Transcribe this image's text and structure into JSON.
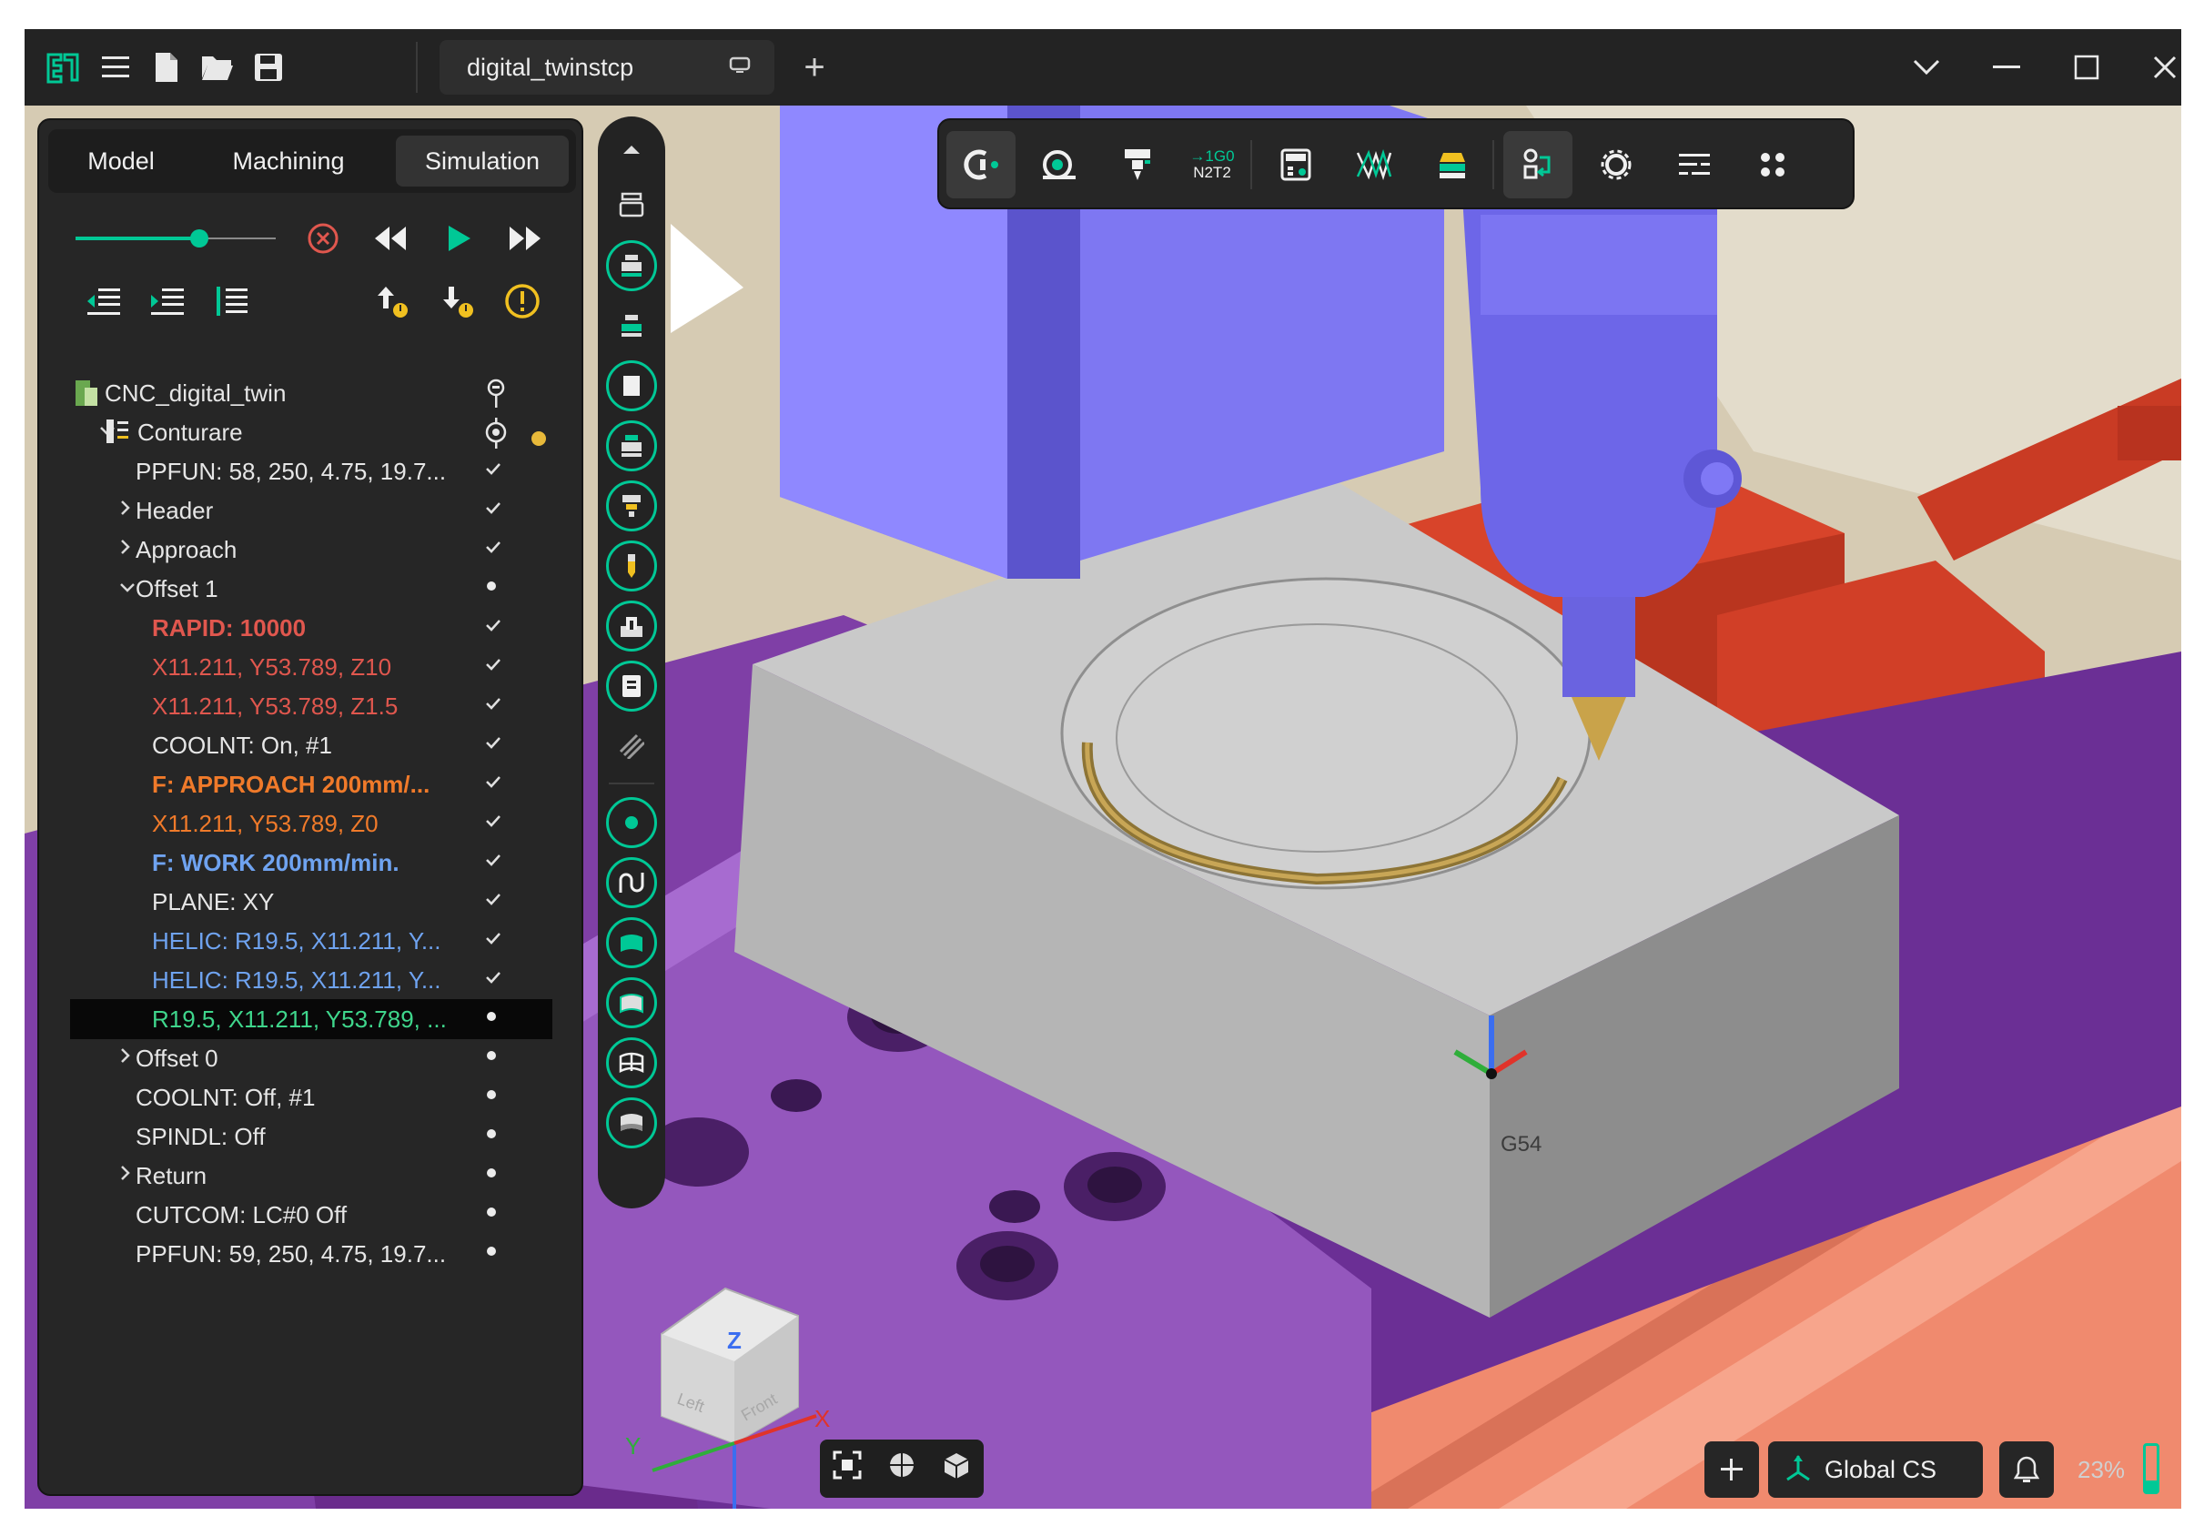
{
  "titlebar": {
    "tab_title": "digital_twinstcp",
    "new_tab_label": "+",
    "icons": [
      "app-logo-icon",
      "menu-icon",
      "new-file-icon",
      "open-folder-icon",
      "save-icon",
      "chevron-down-icon",
      "minimize-icon",
      "maximize-icon",
      "close-icon"
    ]
  },
  "panel": {
    "tabs": [
      {
        "label": "Model",
        "active": false
      },
      {
        "label": "Machining",
        "active": false
      },
      {
        "label": "Simulation",
        "active": true
      }
    ],
    "simulation_speed": 0.62,
    "tree": [
      {
        "label": "CNC_digital_twin",
        "color": "#e6e6e6",
        "bold": false,
        "indent": 0,
        "caret": "",
        "mark": "pin-icon"
      },
      {
        "label": "Conturare",
        "color": "#e6e6e6",
        "bold": false,
        "indent": 1,
        "caret": "expanded",
        "mark": "target-icon"
      },
      {
        "label": "PPFUN: 58, 250, 4.75, 19.7...",
        "color": "#e6e6e6",
        "bold": false,
        "indent": 2,
        "caret": "",
        "mark": "check"
      },
      {
        "label": "Header",
        "color": "#e6e6e6",
        "bold": false,
        "indent": 2,
        "caret": "collapsed",
        "mark": "check"
      },
      {
        "label": "Approach",
        "color": "#e6e6e6",
        "bold": false,
        "indent": 2,
        "caret": "collapsed",
        "mark": "check"
      },
      {
        "label": "Offset 1",
        "color": "#e6e6e6",
        "bold": false,
        "indent": 2,
        "caret": "expanded",
        "mark": "dot"
      },
      {
        "label": "RAPID: 10000",
        "color": "#e0574e",
        "bold": true,
        "indent": 3,
        "caret": "",
        "mark": "check"
      },
      {
        "label": "X11.211, Y53.789, Z10",
        "color": "#e0574e",
        "bold": false,
        "indent": 3,
        "caret": "",
        "mark": "check"
      },
      {
        "label": "X11.211, Y53.789, Z1.5",
        "color": "#e0574e",
        "bold": false,
        "indent": 3,
        "caret": "",
        "mark": "check"
      },
      {
        "label": "COOLNT: On, #1",
        "color": "#e6e6e6",
        "bold": false,
        "indent": 3,
        "caret": "",
        "mark": "check"
      },
      {
        "label": "F: APPROACH 200mm/...",
        "color": "#f07a2a",
        "bold": true,
        "indent": 3,
        "caret": "",
        "mark": "check"
      },
      {
        "label": "X11.211, Y53.789, Z0",
        "color": "#f07a2a",
        "bold": false,
        "indent": 3,
        "caret": "",
        "mark": "check"
      },
      {
        "label": "F: WORK 200mm/min.",
        "color": "#6fa3f0",
        "bold": true,
        "indent": 3,
        "caret": "",
        "mark": "check"
      },
      {
        "label": "PLANE: XY",
        "color": "#e6e6e6",
        "bold": false,
        "indent": 3,
        "caret": "",
        "mark": "check"
      },
      {
        "label": "HELIC: R19.5, X11.211, Y...",
        "color": "#6fa3f0",
        "bold": false,
        "indent": 3,
        "caret": "",
        "mark": "check"
      },
      {
        "label": "HELIC: R19.5, X11.211, Y...",
        "color": "#6fa3f0",
        "bold": false,
        "indent": 3,
        "caret": "",
        "mark": "check"
      },
      {
        "label": "R19.5, X11.211, Y53.789, ...",
        "color": "#3fd68c",
        "bold": false,
        "indent": 3,
        "caret": "",
        "mark": "dot",
        "selected": true
      },
      {
        "label": "Offset 0",
        "color": "#e6e6e6",
        "bold": false,
        "indent": 2,
        "caret": "collapsed",
        "mark": "dot"
      },
      {
        "label": "COOLNT: Off, #1",
        "color": "#e6e6e6",
        "bold": false,
        "indent": 2,
        "caret": "",
        "mark": "dot"
      },
      {
        "label": "SPINDL: Off",
        "color": "#e6e6e6",
        "bold": false,
        "indent": 2,
        "caret": "",
        "mark": "dot"
      },
      {
        "label": "Return",
        "color": "#e6e6e6",
        "bold": false,
        "indent": 2,
        "caret": "collapsed",
        "mark": "dot"
      },
      {
        "label": "CUTCOM: LC#0 Off",
        "color": "#e6e6e6",
        "bold": false,
        "indent": 2,
        "caret": "",
        "mark": "dot"
      },
      {
        "label": "PPFUN: 59, 250, 4.75, 19.7...",
        "color": "#e6e6e6",
        "bold": false,
        "indent": 2,
        "caret": "",
        "mark": "dot"
      }
    ]
  },
  "toolbar": {
    "n2t2_top": "→1G0",
    "n2t2_bottom": "N2T2"
  },
  "viewport": {
    "wcs_label": "G54",
    "axis_x": "X",
    "axis_y": "Y",
    "axis_z": "Z",
    "cube_left": "Left",
    "cube_front": "Front"
  },
  "statusbar": {
    "coord_system": "Global CS",
    "zoom": "23%",
    "battery_level": 0.25
  },
  "colors": {
    "accent": "#00c896",
    "workpiece": "#c9c9c9",
    "spindle": "#7b74f0",
    "vise": "#7f3fa6",
    "clamp": "#d8442a",
    "table": "#f08a6e"
  }
}
